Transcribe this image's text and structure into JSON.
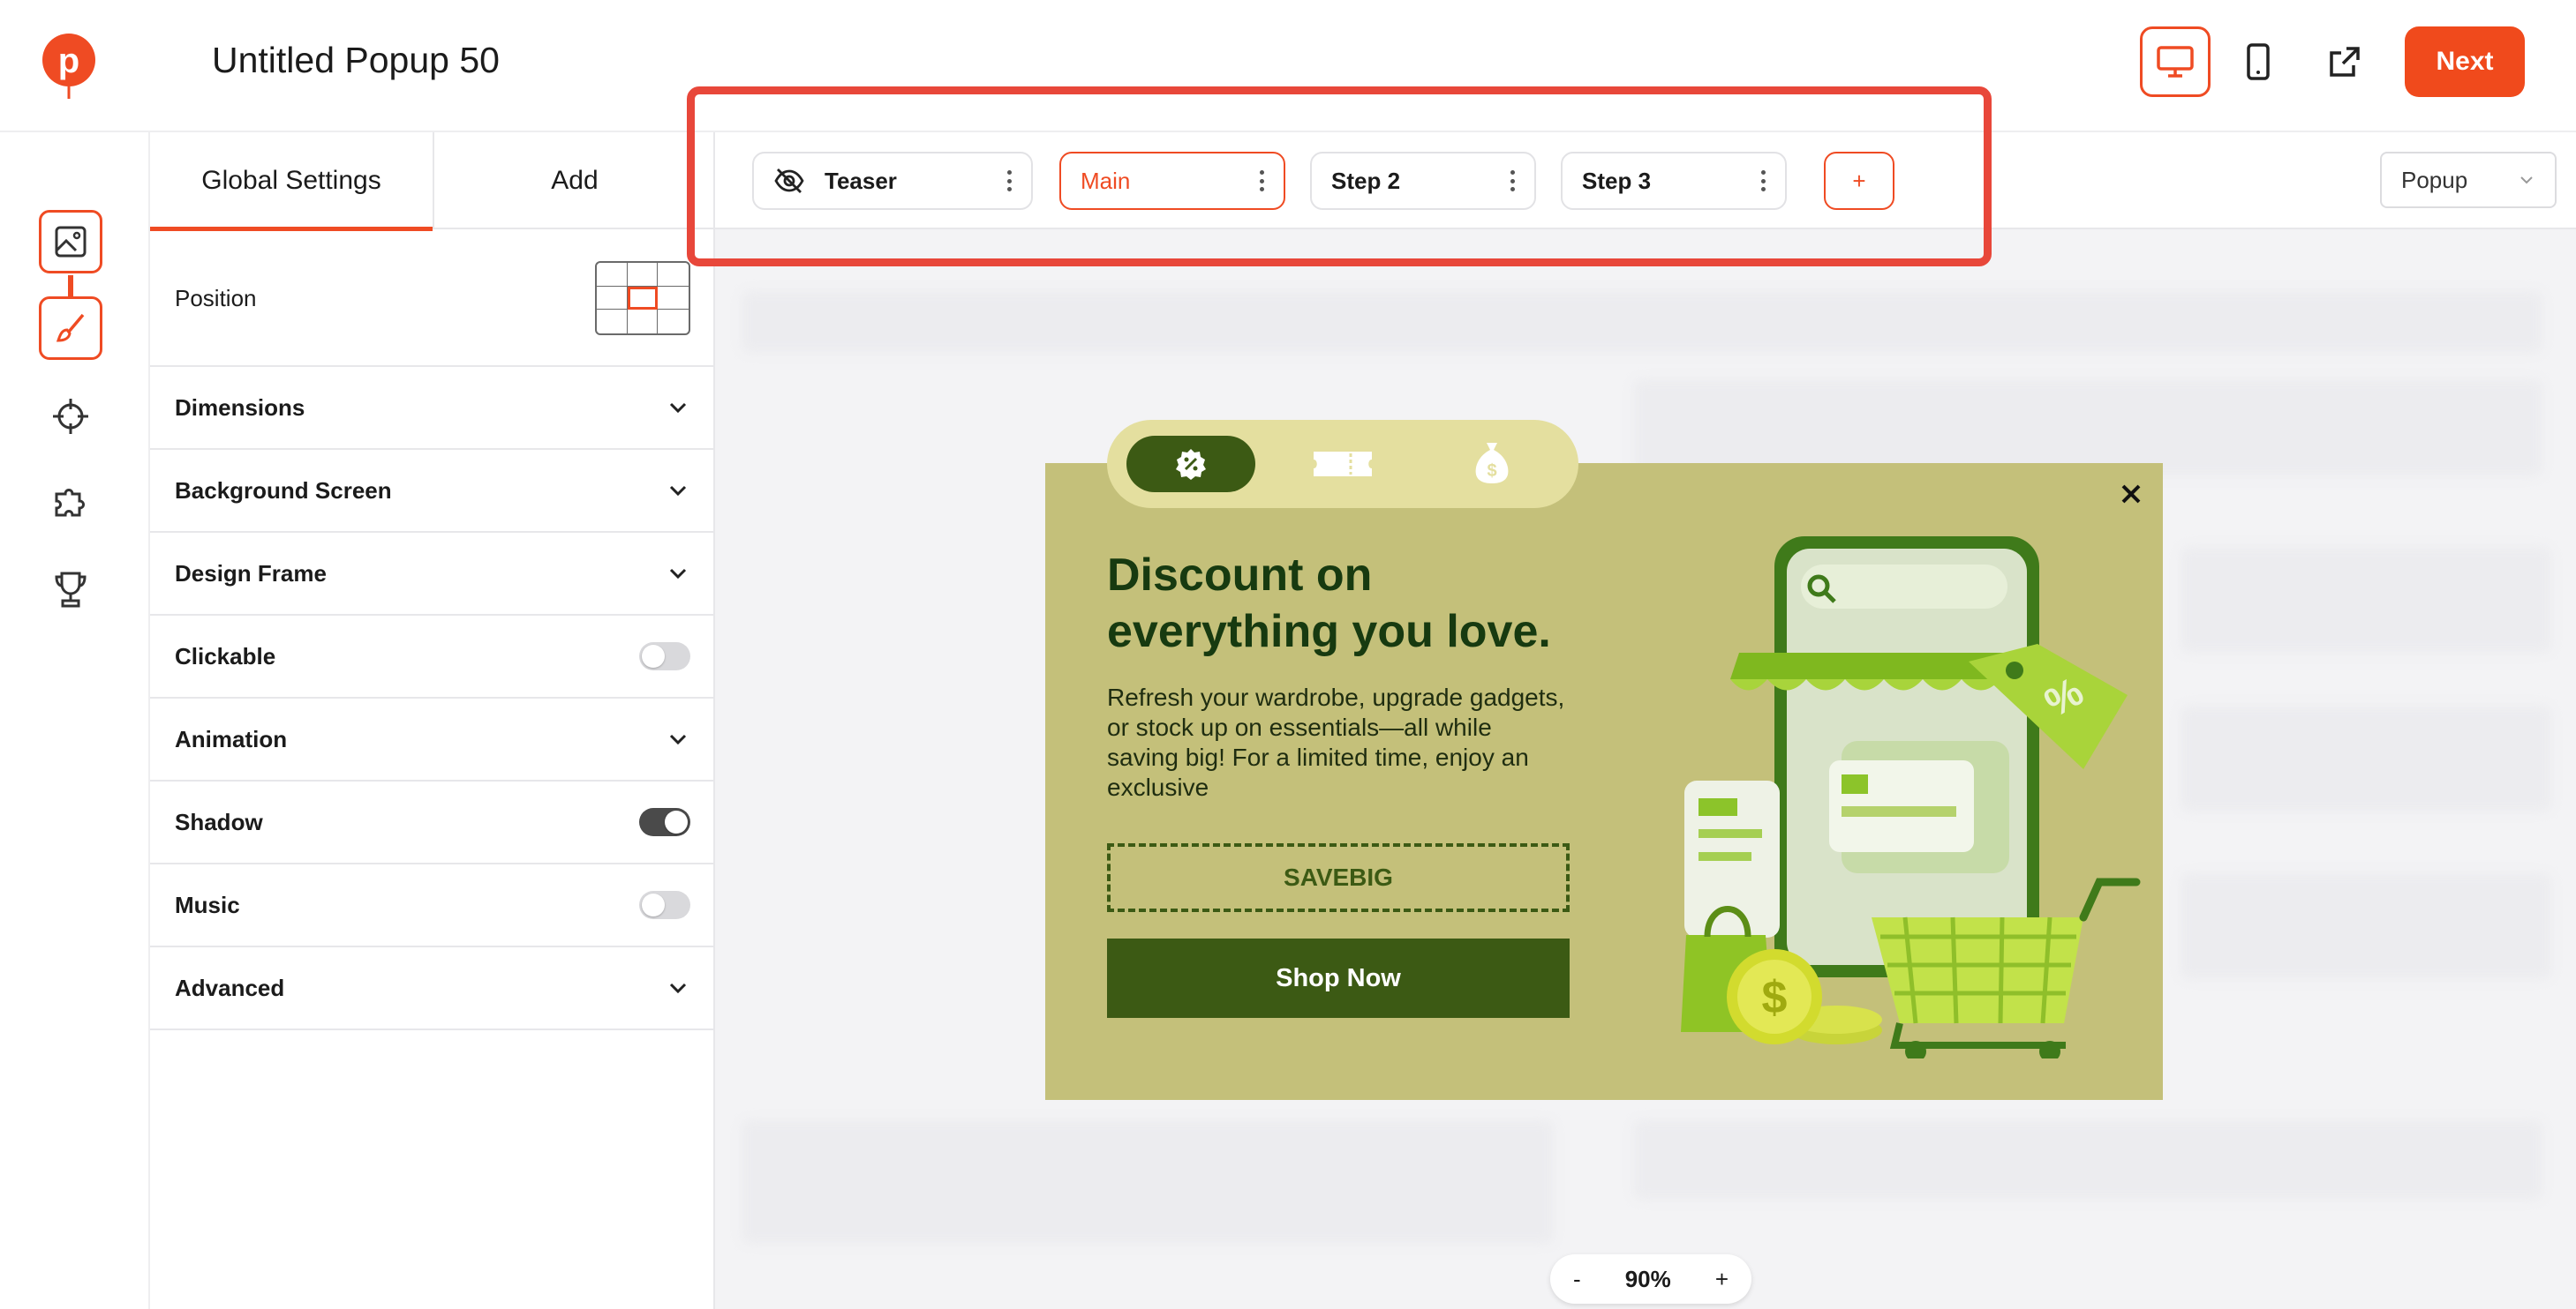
{
  "app": {
    "title": "Untitled Popup 50",
    "next_label": "Next"
  },
  "panel": {
    "tabs": [
      {
        "label": "Global Settings",
        "active": true
      },
      {
        "label": "Add",
        "active": false
      }
    ],
    "position_label": "Position",
    "rows": {
      "dimensions": "Dimensions",
      "background_screen": "Background Screen",
      "design_frame": "Design Frame",
      "clickable": "Clickable",
      "animation": "Animation",
      "shadow": "Shadow",
      "music": "Music",
      "advanced": "Advanced"
    },
    "toggles": {
      "clickable": false,
      "shadow": true,
      "music": false
    }
  },
  "steps": [
    {
      "label": "Teaser",
      "active": false
    },
    {
      "label": "Main",
      "active": true
    },
    {
      "label": "Step 2",
      "active": false
    },
    {
      "label": "Step 3",
      "active": false
    }
  ],
  "add_step_label": "+",
  "type_select": {
    "value": "Popup"
  },
  "popup": {
    "heading": "Discount on everything you love.",
    "body": "Refresh your wardrobe, upgrade gadgets, or stock up on essentials—all while saving big! For a limited time, enjoy an exclusive",
    "coupon": "SAVEBIG",
    "cta": "Shop Now"
  },
  "zoom": {
    "minus": "-",
    "value": "90%",
    "plus": "+"
  },
  "colors": {
    "accent": "#ef4b23",
    "popup_bg": "#c4c07a",
    "popup_dark": "#3c5a14",
    "highlight": "#e8473a"
  }
}
